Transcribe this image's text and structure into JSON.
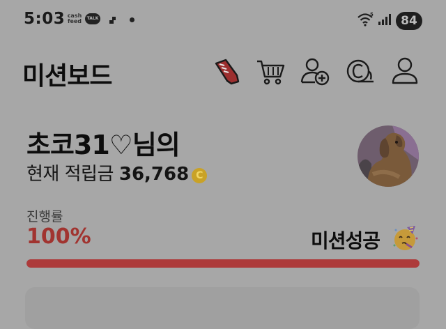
{
  "status_bar": {
    "time": "5:03",
    "cashfeed": [
      "cash",
      "feed"
    ],
    "talk_badge": "TALK",
    "battery": "84",
    "icons": [
      "cashfeed-icon",
      "kakaotalk-icon",
      "stairs-icon",
      "notification-dot",
      "wifi-5g-icon",
      "signal-icon",
      "battery-icon"
    ]
  },
  "header": {
    "title": "미션보드",
    "icons": [
      "sneaker-icon",
      "shopping-cart-icon",
      "add-friend-icon",
      "coin-history-icon",
      "profile-icon"
    ]
  },
  "user": {
    "nickname": "초코31♡님의",
    "points_label": "현재 적립금",
    "points_value": "36,768",
    "coin_symbol": "C"
  },
  "progress": {
    "label": "진행률",
    "value_text": "100%",
    "value": 1.0,
    "status": "미션성공"
  },
  "colors": {
    "background": "#a7a7a7",
    "accent": "#a13430",
    "progress_bar": "#ad3a3a",
    "coin": "#c9a227"
  }
}
